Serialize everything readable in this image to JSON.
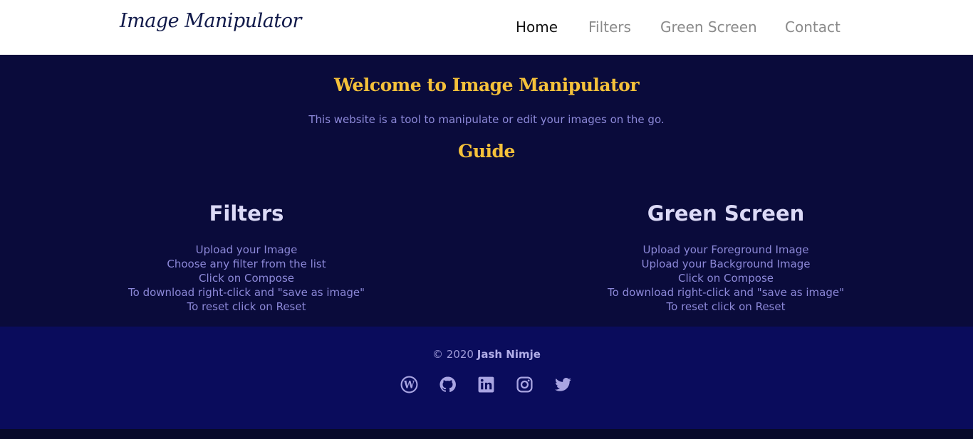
{
  "nav": {
    "logo": "Image Manipulator",
    "links": [
      "Home",
      "Filters",
      "Green Screen",
      "Contact"
    ],
    "active_link": "Home"
  },
  "hero": {
    "title": "Welcome to Image Manipulator",
    "intro": "This website is a tool to manipulate or edit your images on the go.",
    "guide_title": "Guide"
  },
  "sections": [
    {
      "title": "Filters",
      "steps": [
        "Upload your Image",
        "Choose any filter from the list",
        "Click on Compose",
        "To download right-click and \"save as image\"",
        "To reset click on Reset"
      ]
    },
    {
      "title": "Green Screen",
      "steps": [
        "Upload your Foreground Image",
        "Upload your Background Image",
        "Click on Compose",
        "To download right-click and \"save as image\"",
        "To reset click on Reset"
      ]
    }
  ],
  "footer": {
    "copyright_prefix": "© 2020",
    "author": "Jash Nimje",
    "social_icons": [
      "wordpress-icon",
      "github-icon",
      "linkedin-icon",
      "instagram-icon",
      "twitter-icon"
    ]
  },
  "colors": {
    "accent_yellow": "#f5c13a",
    "hero_background": "#0a0b3b",
    "footer_background": "#0a0c5c",
    "body_text": "#8c88d8",
    "icon_color": "#a9a5e2"
  }
}
